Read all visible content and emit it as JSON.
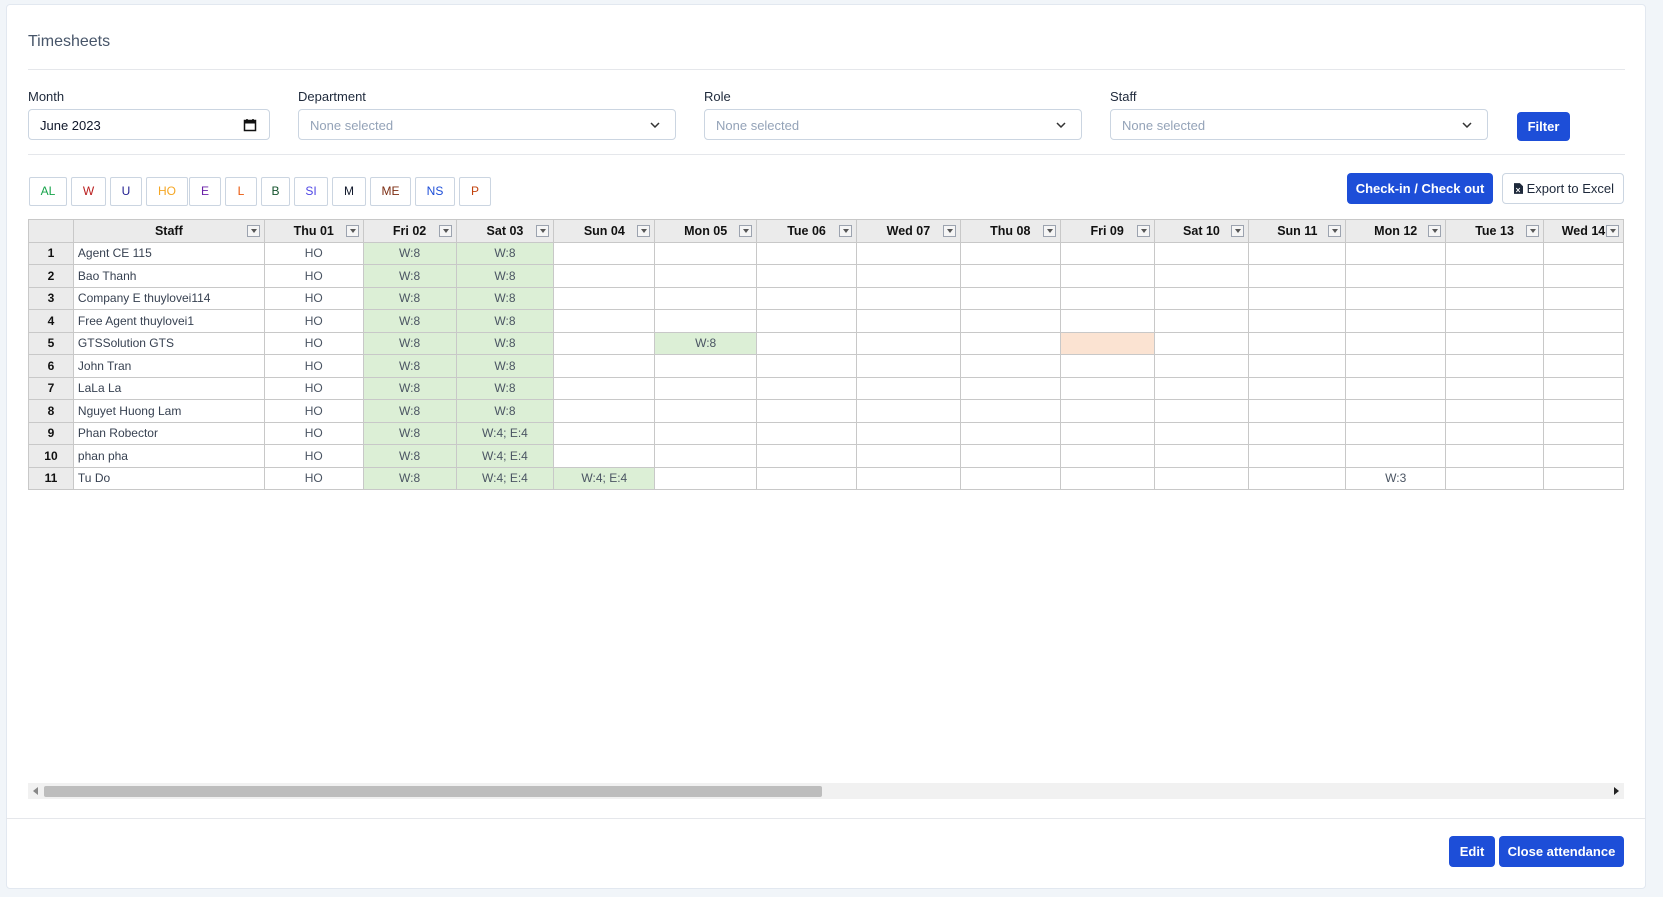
{
  "page": {
    "title": "Timesheets"
  },
  "filters": {
    "month_label": "Month",
    "month_value": "June 2023",
    "department_label": "Department",
    "department_value": "None selected",
    "role_label": "Role",
    "role_value": "None selected",
    "staff_label": "Staff",
    "staff_value": "None selected",
    "filter_button": "Filter"
  },
  "legend": [
    {
      "code": "AL",
      "color": "#16a34a"
    },
    {
      "code": "W",
      "color": "#b91c1c"
    },
    {
      "code": "U",
      "color": "#1e1b8f"
    },
    {
      "code": "HO",
      "color": "#f5a623"
    },
    {
      "code": "E",
      "color": "#6b21a8"
    },
    {
      "code": "L",
      "color": "#ea580c"
    },
    {
      "code": "B",
      "color": "#14532d"
    },
    {
      "code": "SI",
      "color": "#4f46e5"
    },
    {
      "code": "M",
      "color": "#0f172a"
    },
    {
      "code": "ME",
      "color": "#7c2d12"
    },
    {
      "code": "NS",
      "color": "#1d4ed8"
    },
    {
      "code": "P",
      "color": "#c2410c"
    }
  ],
  "toolbar": {
    "checkin_label": "Check-in / Check out",
    "export_label": "Export to Excel"
  },
  "table": {
    "staff_header": "Staff",
    "day_headers": [
      "Thu 01",
      "Fri 02",
      "Sat 03",
      "Sun 04",
      "Mon 05",
      "Tue 06",
      "Wed 07",
      "Thu 08",
      "Fri 09",
      "Sat 10",
      "Sun 11",
      "Mon 12",
      "Tue 13",
      "Wed 14"
    ],
    "rows": [
      {
        "num": "1",
        "name": "Agent CE 115",
        "cells": [
          "HO",
          "W:8",
          "W:8",
          "",
          "",
          "",
          "",
          "",
          "",
          "",
          "",
          "",
          "",
          ""
        ],
        "colors": [
          "",
          "g",
          "g",
          "",
          "",
          "",
          "",
          "",
          "",
          "",
          "",
          "",
          "",
          ""
        ]
      },
      {
        "num": "2",
        "name": "Bao Thanh",
        "cells": [
          "HO",
          "W:8",
          "W:8",
          "",
          "",
          "",
          "",
          "",
          "",
          "",
          "",
          "",
          "",
          ""
        ],
        "colors": [
          "",
          "g",
          "g",
          "",
          "",
          "",
          "",
          "",
          "",
          "",
          "",
          "",
          "",
          ""
        ]
      },
      {
        "num": "3",
        "name": "Company E thuylovei114",
        "cells": [
          "HO",
          "W:8",
          "W:8",
          "",
          "",
          "",
          "",
          "",
          "",
          "",
          "",
          "",
          "",
          ""
        ],
        "colors": [
          "",
          "g",
          "g",
          "",
          "",
          "",
          "",
          "",
          "",
          "",
          "",
          "",
          "",
          ""
        ]
      },
      {
        "num": "4",
        "name": "Free Agent thuylovei1",
        "cells": [
          "HO",
          "W:8",
          "W:8",
          "",
          "",
          "",
          "",
          "",
          "",
          "",
          "",
          "",
          "",
          ""
        ],
        "colors": [
          "",
          "g",
          "g",
          "",
          "",
          "",
          "",
          "",
          "",
          "",
          "",
          "",
          "",
          ""
        ]
      },
      {
        "num": "5",
        "name": "GTSSolution GTS",
        "cells": [
          "HO",
          "W:8",
          "W:8",
          "",
          "W:8",
          "",
          "",
          "",
          "",
          "",
          "",
          "",
          "",
          ""
        ],
        "colors": [
          "",
          "g",
          "g",
          "",
          "g",
          "",
          "",
          "",
          "p",
          "",
          "",
          "",
          "",
          ""
        ]
      },
      {
        "num": "6",
        "name": "John Tran",
        "cells": [
          "HO",
          "W:8",
          "W:8",
          "",
          "",
          "",
          "",
          "",
          "",
          "",
          "",
          "",
          "",
          ""
        ],
        "colors": [
          "",
          "g",
          "g",
          "",
          "",
          "",
          "",
          "",
          "",
          "",
          "",
          "",
          "",
          ""
        ]
      },
      {
        "num": "7",
        "name": "LaLa La",
        "cells": [
          "HO",
          "W:8",
          "W:8",
          "",
          "",
          "",
          "",
          "",
          "",
          "",
          "",
          "",
          "",
          ""
        ],
        "colors": [
          "",
          "g",
          "g",
          "",
          "",
          "",
          "",
          "",
          "",
          "",
          "",
          "",
          "",
          ""
        ]
      },
      {
        "num": "8",
        "name": "Nguyet Huong Lam",
        "cells": [
          "HO",
          "W:8",
          "W:8",
          "",
          "",
          "",
          "",
          "",
          "",
          "",
          "",
          "",
          "",
          ""
        ],
        "colors": [
          "",
          "g",
          "g",
          "",
          "",
          "",
          "",
          "",
          "",
          "",
          "",
          "",
          "",
          ""
        ]
      },
      {
        "num": "9",
        "name": "Phan Robector",
        "cells": [
          "HO",
          "W:8",
          "W:4; E:4",
          "",
          "",
          "",
          "",
          "",
          "",
          "",
          "",
          "",
          "",
          ""
        ],
        "colors": [
          "",
          "g",
          "g",
          "",
          "",
          "",
          "",
          "",
          "",
          "",
          "",
          "",
          "",
          ""
        ]
      },
      {
        "num": "10",
        "name": "phan pha",
        "cells": [
          "HO",
          "W:8",
          "W:4; E:4",
          "",
          "",
          "",
          "",
          "",
          "",
          "",
          "",
          "",
          "",
          ""
        ],
        "colors": [
          "",
          "g",
          "g",
          "",
          "",
          "",
          "",
          "",
          "",
          "",
          "",
          "",
          "",
          ""
        ]
      },
      {
        "num": "11",
        "name": "Tu Do",
        "cells": [
          "HO",
          "W:8",
          "W:4; E:4",
          "W:4; E:4",
          "",
          "",
          "",
          "",
          "",
          "",
          "",
          "W:3",
          "",
          ""
        ],
        "colors": [
          "",
          "g",
          "g",
          "g",
          "",
          "",
          "",
          "",
          "",
          "",
          "",
          "",
          "",
          ""
        ]
      }
    ]
  },
  "footer": {
    "edit_label": "Edit",
    "close_label": "Close attendance"
  }
}
